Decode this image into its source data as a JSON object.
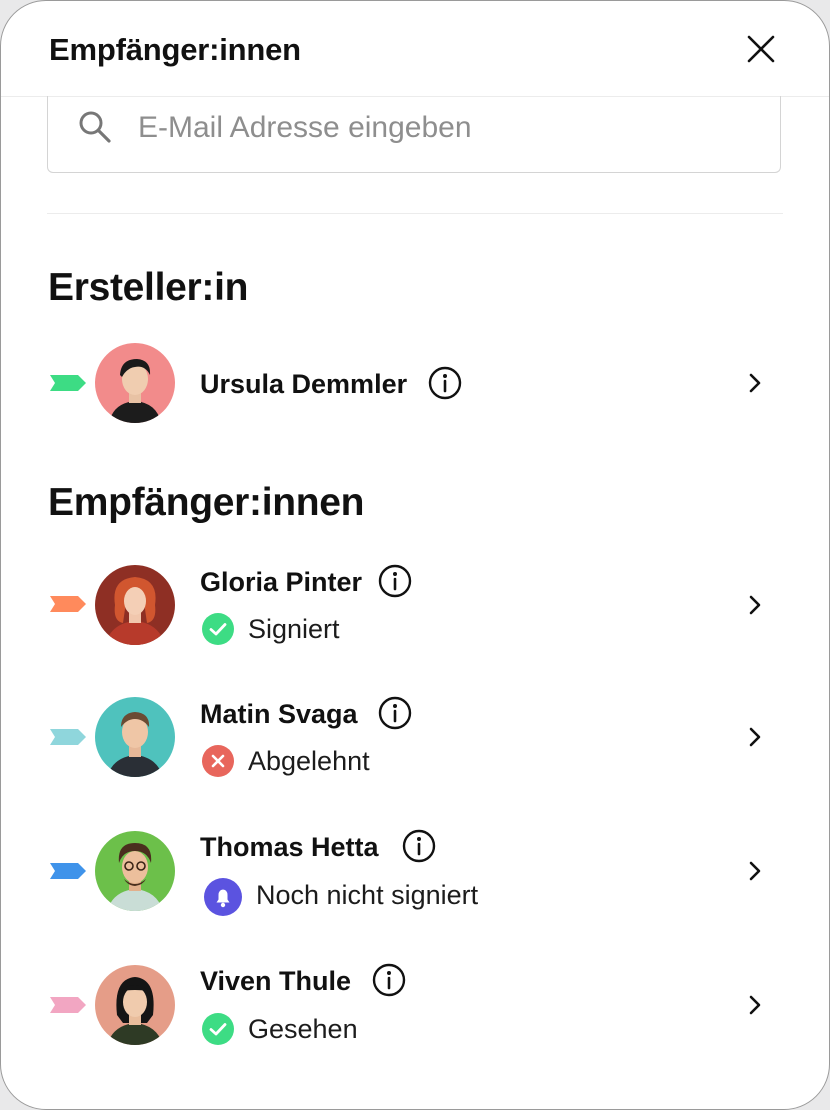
{
  "header": {
    "title": "Empfänger:innen"
  },
  "search": {
    "placeholder": "E-Mail Adresse eingeben",
    "value": ""
  },
  "creator_section": {
    "title": "Ersteller:in",
    "person": {
      "name": "Ursula Demmler",
      "tag_color": "#3ddc84",
      "avatar_bg": "#f28b8b"
    }
  },
  "recipients_section": {
    "title": "Empfänger:innen",
    "people": [
      {
        "name": "Gloria Pinter",
        "status": "Signiert",
        "status_type": "signed",
        "tag_color": "#ff8a5c",
        "avatar_bg": "#8e2f24"
      },
      {
        "name": "Matin Svaga",
        "status": "Abgelehnt",
        "status_type": "declined",
        "tag_color": "#8fd6dc",
        "avatar_bg": "#4fc2bd"
      },
      {
        "name": "Thomas Hetta",
        "status": "Noch nicht signiert",
        "status_type": "pending",
        "tag_color": "#3f93ea",
        "avatar_bg": "#6cc04a"
      },
      {
        "name": "Viven Thule",
        "status": "Gesehen",
        "status_type": "seen",
        "tag_color": "#f2a6c2",
        "avatar_bg": "#e59d88"
      }
    ]
  },
  "colors": {
    "signed": "#3ddc84",
    "declined": "#e8665c",
    "pending": "#5b53e0",
    "seen": "#3ddc84"
  }
}
